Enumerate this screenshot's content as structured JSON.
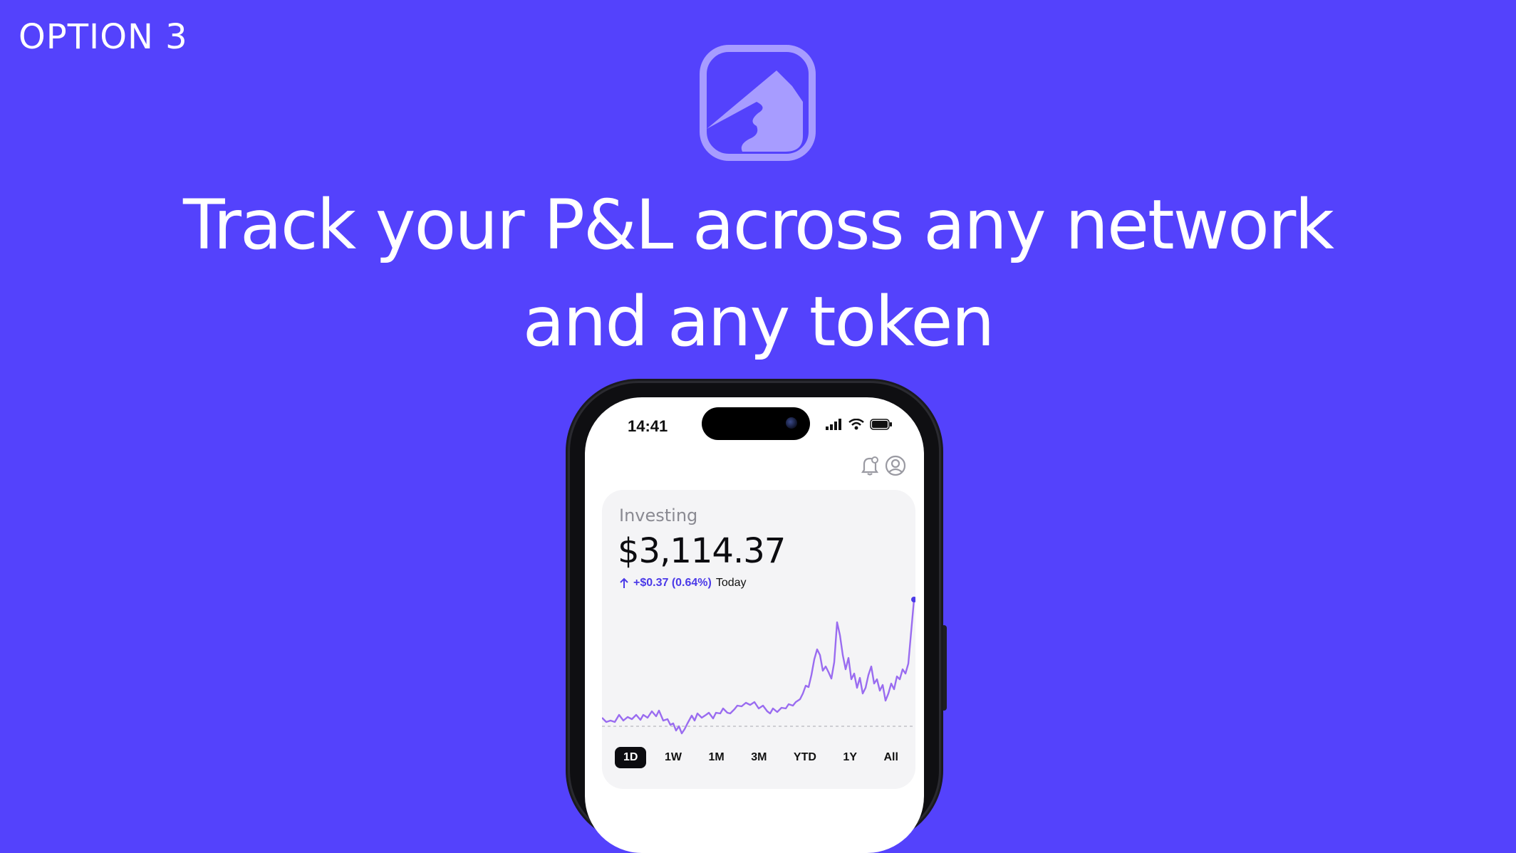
{
  "option_label": "OPTION 3",
  "logo_icon": "portfolio-chart-logo-icon",
  "headline": {
    "line1": "Track your P&L across any network",
    "line2": "and any token"
  },
  "phone": {
    "status": {
      "time": "14:41",
      "icons": [
        "cellular-signal-icon",
        "wifi-icon",
        "battery-icon"
      ]
    },
    "header_icons": [
      "bell-icon",
      "profile-icon"
    ],
    "card": {
      "title": "Investing",
      "value": "$3,114.37",
      "change_value": "+$0.37 (0.64%)",
      "change_label": "Today",
      "accent_color": "#4b3ae8",
      "line_color": "#9a6cf0"
    },
    "ranges": [
      "1D",
      "1W",
      "1M",
      "3M",
      "YTD",
      "1Y",
      "All"
    ],
    "active_range": "1D"
  },
  "colors": {
    "background": "#5442fc",
    "logo": "#a79cff"
  }
}
